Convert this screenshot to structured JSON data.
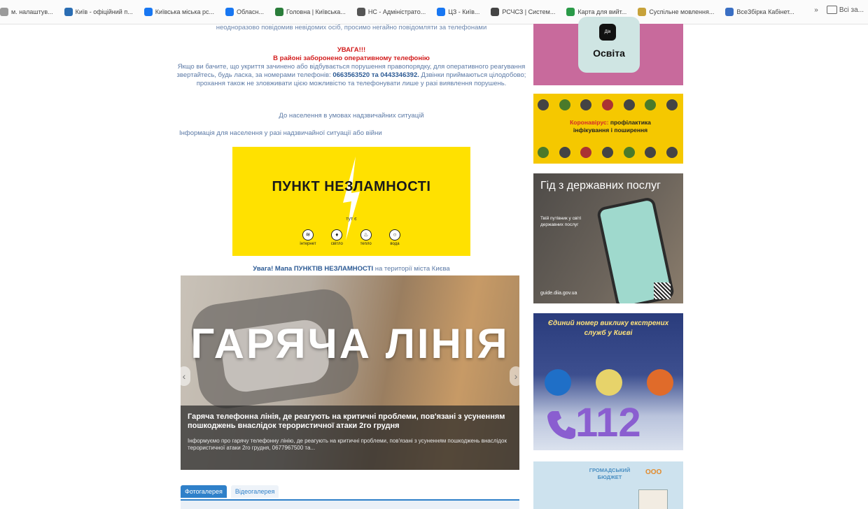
{
  "bookmarks": {
    "items": [
      {
        "label": "м. налаштув...",
        "color": "#9a9a9a"
      },
      {
        "label": "Київ - офіційний п...",
        "color": "#2a6db3"
      },
      {
        "label": "Київська міська рс...",
        "color": "#1877f2"
      },
      {
        "label": "Обласн...",
        "color": "#1877f2"
      },
      {
        "label": "Головна | Київська...",
        "color": "#2a7d3a"
      },
      {
        "label": "НС - Адміністрато...",
        "color": "#555555"
      },
      {
        "label": "ЦЗ - Київ...",
        "color": "#1877f2"
      },
      {
        "label": "РСЧСЗ | Систем...",
        "color": "#444444"
      },
      {
        "label": "Карта для вийт...",
        "color": "#2a9a48"
      },
      {
        "label": "Суспільне мовлення...",
        "color": "#c7a23a"
      },
      {
        "label": "ВсеЗбірка Кабінет...",
        "color": "#3a6fc4"
      }
    ],
    "more_label": "»",
    "folder_label": "Всі за..."
  },
  "main": {
    "intro": "неодноразово  повідомив  невідомих осіб,  просимо  негайно  повідомляти за телефонами",
    "notice_title": "УВАГА!!!",
    "notice_subtitle": "В районі заборонено оперативному телефонію",
    "notice_body": "Якщо ви бачите, що укриття зачинено або відбувається порушення правопорядку, для оперативного реагування звертайтесь, будь ласка, за номерами телефонів:",
    "notice_phones": "0663563520 та 0443346392.",
    "notice_tail": "Дзвінки приймаються цілодобово; прохання також не зловживати цією можливістю та телефонувати лише у разі виявлення порушень.",
    "link_population": "До населення в умовах надзвичайних ситуацій",
    "link_info": "Інформація для населення у разі надзвичайної ситуації або війни",
    "banner_title": "ПУНКТ НЕЗЛАМНОСТІ",
    "banner_small": "тут є",
    "banner_items": [
      "інтернет",
      "світло",
      "тепло",
      "вода"
    ],
    "attention_bold": "Увага! Мапа ПУНКТІВ НЕЗЛАМНОСТІ",
    "attention_rest": " на території міста Києва",
    "slide_title": "ГАРЯЧА ЛІНІЯ",
    "slide_heading": "Гаряча телефонна лінія, де реагують на критичні проблеми, пов'язані з усуненням пошкоджень внаслідок терористичної атаки 2го грудня",
    "slide_text": "Інформуємо про гарячу телефонну лінію, де реагують на критичні проблеми, пов'язані з усуненням пошкоджень внаслідок терористичної атаки 2го грудня, 0677967500 та...",
    "slide_prev": "‹",
    "slide_next": "›",
    "tabs": [
      "Фотогалерея",
      "Відеогалерея"
    ]
  },
  "sidebar": {
    "osvita_brand": "Дія",
    "osvita_label": "Освіта",
    "corona_red": "Коронавірус:",
    "corona_text": "профілактика інфікування і поширення",
    "guide_title": "Гід з державних послуг",
    "guide_sub": "Твій путівник у світі державних послуг",
    "guide_url": "guide.diia.gov.ua",
    "emergency_title": "Єдиний номер виклику екстрених служб у Києві",
    "emergency_number": "112",
    "budget_title": "ГРОМАДСЬКИЙ БЮДЖЕТ",
    "budget_logo": "ООО"
  }
}
